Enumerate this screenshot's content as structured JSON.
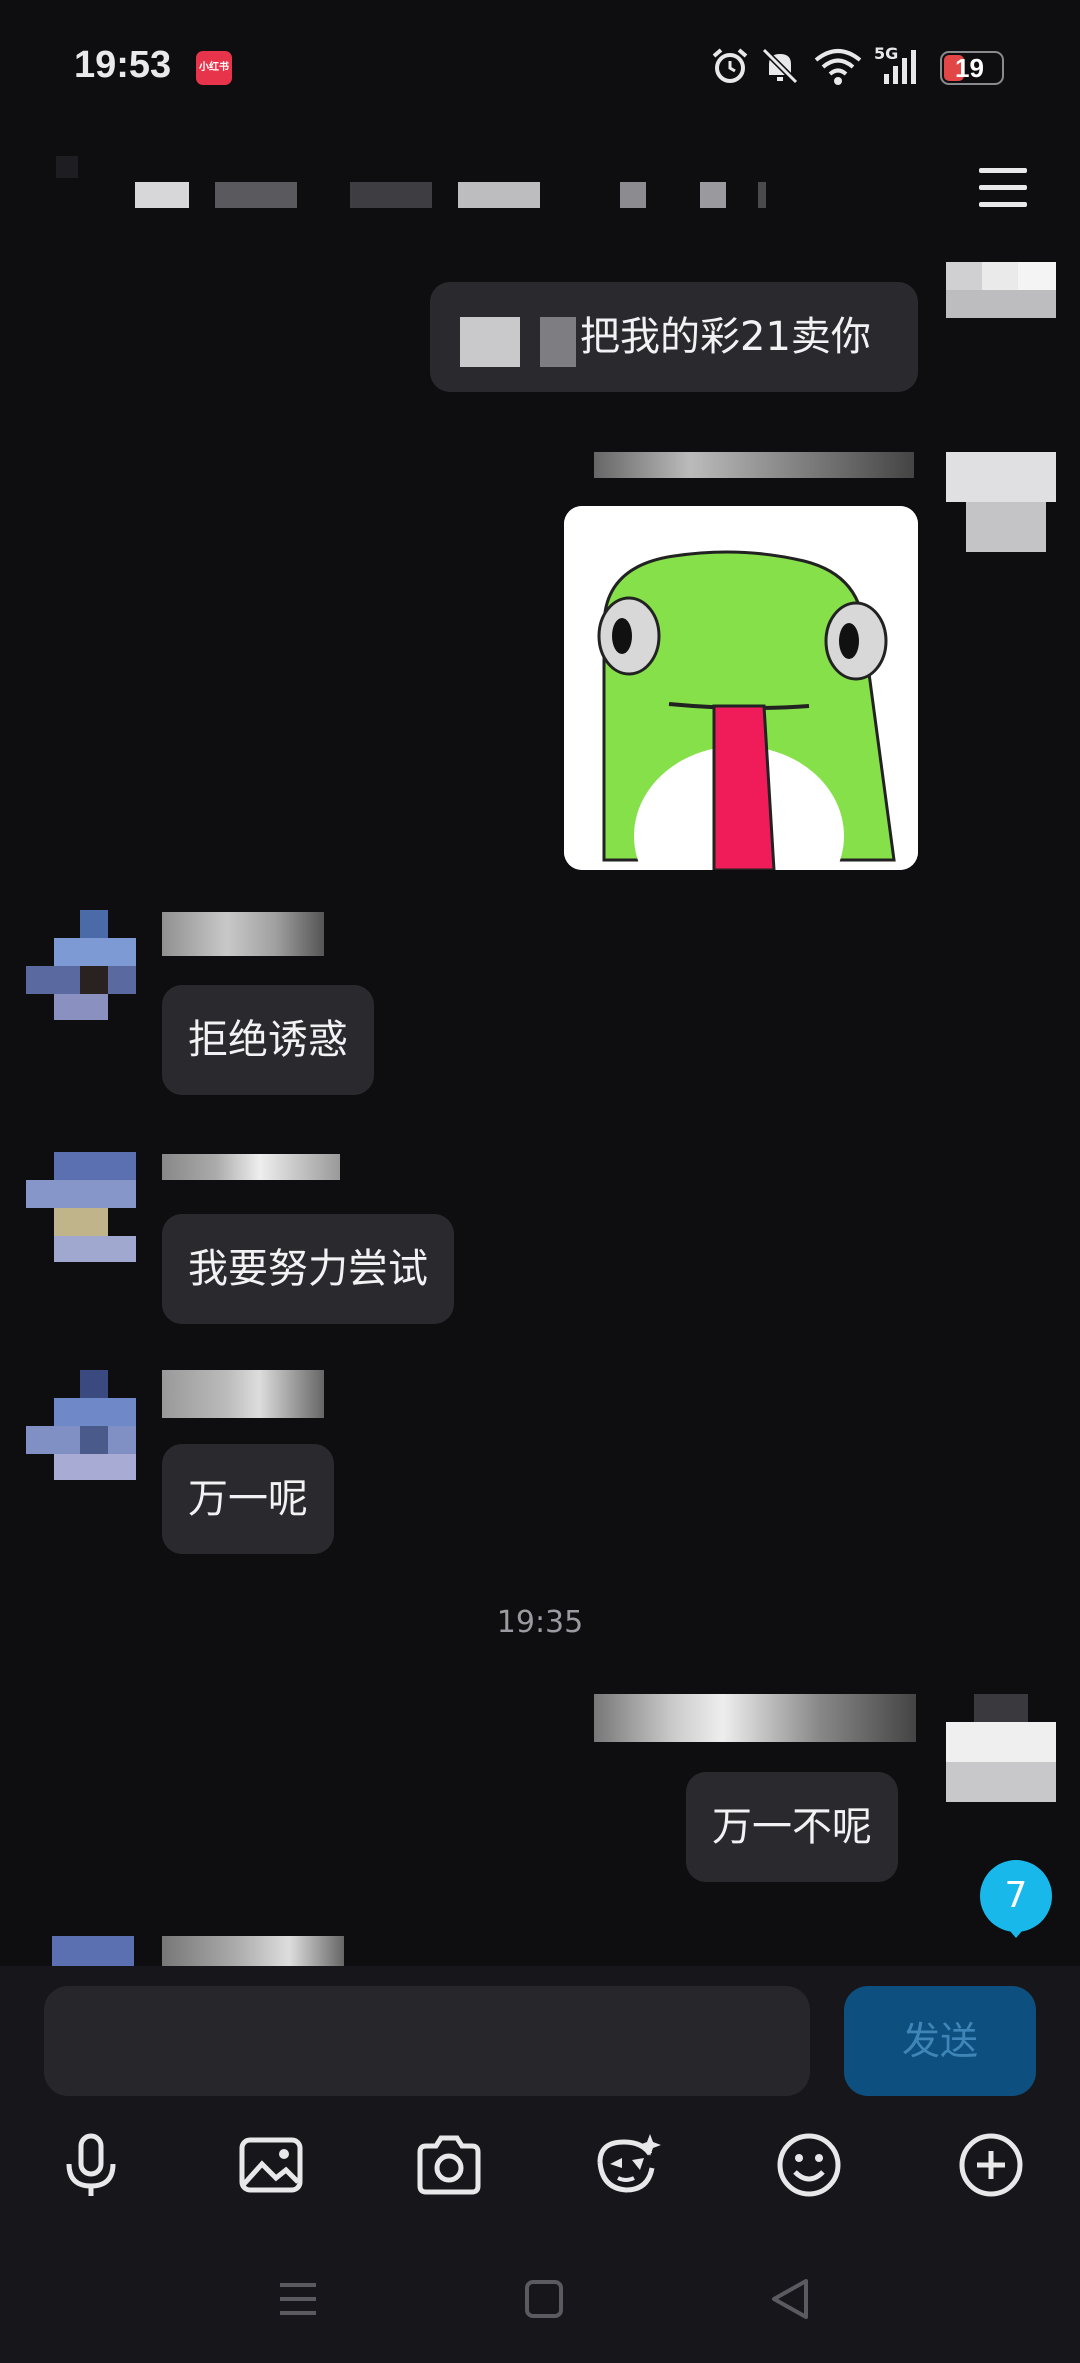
{
  "status_bar": {
    "time": "19:53",
    "app_badge": "小红书",
    "network": "5G",
    "battery": "19",
    "icons": [
      "alarm-icon",
      "mute-bell-icon",
      "wifi-icon",
      "signal-5g-icon",
      "battery-icon"
    ]
  },
  "header": {
    "title_redacted": true,
    "menu_icon": "hamburger-menu-icon"
  },
  "messages": [
    {
      "side": "right",
      "type": "text",
      "text": "把我的彩21卖你",
      "quoted_redacted": true
    },
    {
      "side": "right",
      "type": "sticker",
      "sticker": "green-frog-tongue"
    },
    {
      "side": "left",
      "type": "text",
      "text": "拒绝诱惑"
    },
    {
      "side": "left",
      "type": "text",
      "text": "我要努力尝试"
    },
    {
      "side": "left",
      "type": "text",
      "text": "万一呢"
    },
    {
      "type": "timestamp",
      "text": "19:35"
    },
    {
      "side": "right",
      "type": "text",
      "text": "万一不呢"
    }
  ],
  "unread_badge": "7",
  "composer": {
    "input_value": "",
    "send_label": "发送",
    "tools": [
      "microphone-icon",
      "image-icon",
      "camera-icon",
      "sticker-ai-icon",
      "emoji-icon",
      "plus-icon"
    ]
  },
  "colors": {
    "background": "#0e0e11",
    "bubble": "#2a2a2e",
    "send_button": "#0d4f7f",
    "badge": "#18b8ea"
  }
}
